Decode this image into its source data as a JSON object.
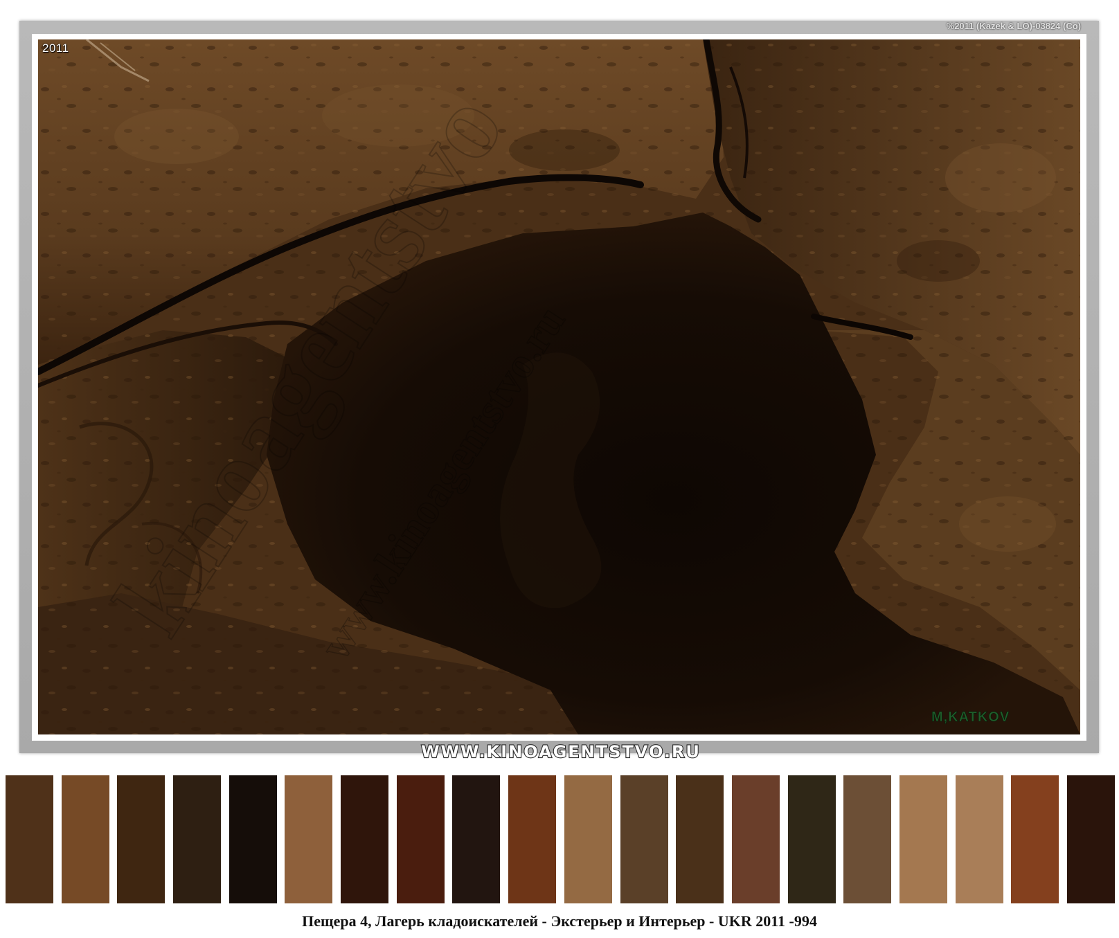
{
  "photo": {
    "year_stamp": "2011",
    "copyright_stamp": "%2011 (Kazek & LO)-03824 (Co)",
    "watermark_diagonal_large": "kinoagentstvo",
    "watermark_diagonal_url": "www.kinoagentstvo.ru",
    "photographer_signature": "M,KATKOV"
  },
  "site_banner": "WWW.KINOAGENTSTVO.RU",
  "palette": [
    "#4f3119",
    "#764a26",
    "#3f2611",
    "#2e1f12",
    "#150d09",
    "#8e603b",
    "#2f150b",
    "#4a1d0e",
    "#221510",
    "#6e3517",
    "#946a43",
    "#5a4028",
    "#4a3019",
    "#6a3e2a",
    "#2f2717",
    "#6c4f36",
    "#a47850",
    "#a97e58",
    "#84401e",
    "#2a140b"
  ],
  "caption": "Пещера 4, Лагерь кладоискателей - Экстерьер и Интерьер - UKR 2011 -994"
}
